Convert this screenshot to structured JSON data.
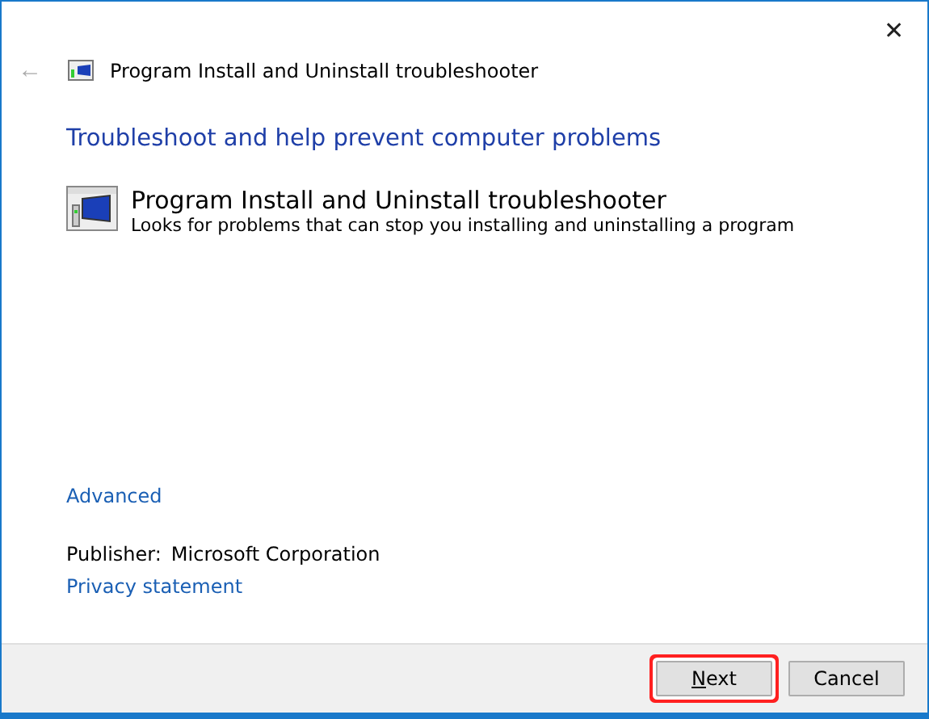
{
  "window": {
    "title": "Program Install and Uninstall troubleshooter",
    "close": "✕",
    "back": "←"
  },
  "heading": "Troubleshoot and help prevent computer problems",
  "troubleshooter": {
    "name": "Program Install and Uninstall troubleshooter",
    "description": "Looks for problems that can stop you installing and uninstalling a program"
  },
  "advanced_link": "Advanced",
  "publisher": {
    "label": "Publisher:",
    "value": "Microsoft Corporation"
  },
  "privacy_link": "Privacy statement",
  "buttons": [
    {
      "label": "Next",
      "highlighted": true,
      "access_key_underlined": true
    },
    {
      "label": "Cancel",
      "highlighted": false,
      "access_key_underlined": false
    }
  ]
}
